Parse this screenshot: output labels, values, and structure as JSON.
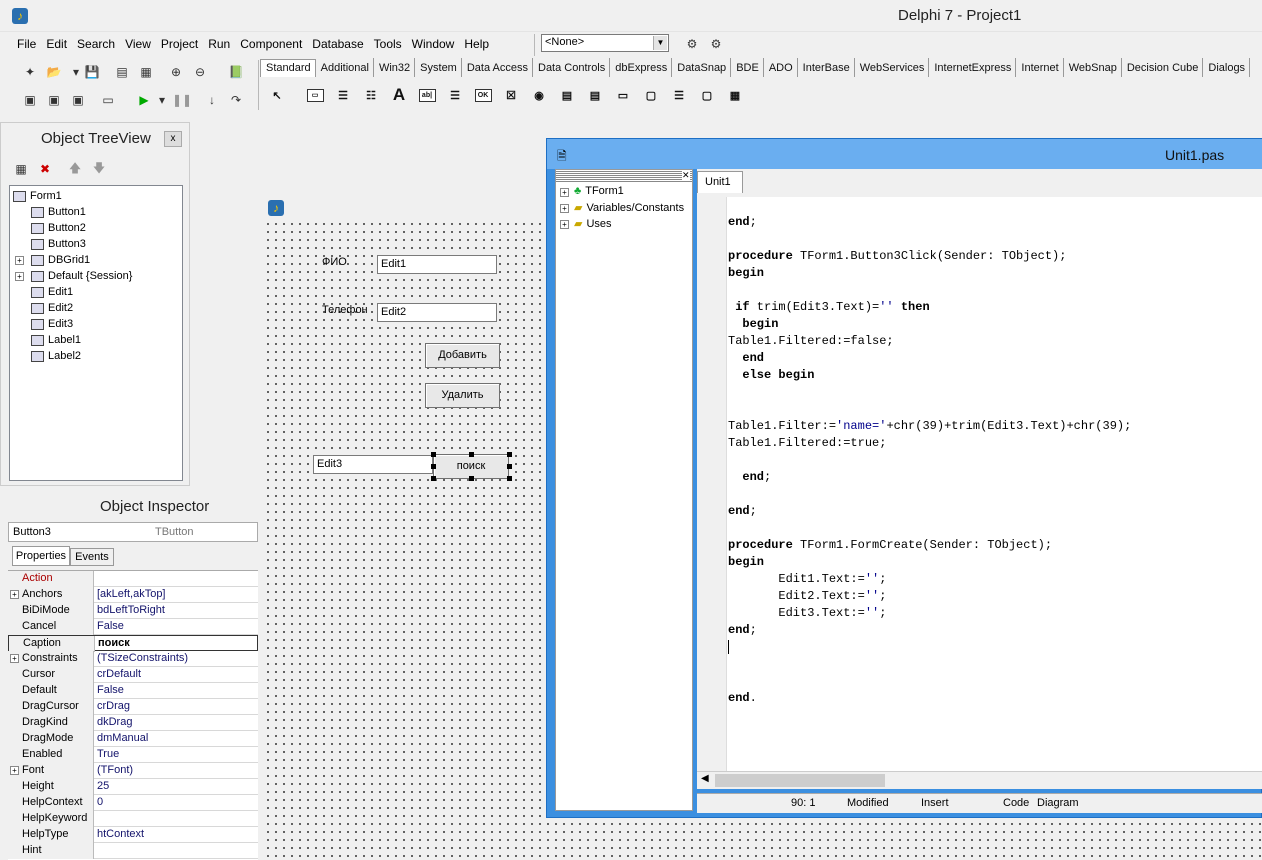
{
  "window": {
    "title": "Delphi 7 - Project1"
  },
  "menu": [
    "File",
    "Edit",
    "Search",
    "View",
    "Project",
    "Run",
    "Component",
    "Database",
    "Tools",
    "Window",
    "Help"
  ],
  "desktop_combo": {
    "value": "<None>"
  },
  "palette_tabs": [
    "Standard",
    "Additional",
    "Win32",
    "System",
    "Data Access",
    "Data Controls",
    "dbExpress",
    "DataSnap",
    "BDE",
    "ADO",
    "InterBase",
    "WebServices",
    "InternetExpress",
    "Internet",
    "WebSnap",
    "Decision Cube",
    "Dialogs"
  ],
  "palette_label_glyph": "A",
  "tree_view": {
    "title": "Object TreeView",
    "close": "x",
    "items": [
      "Form1",
      "Button1",
      "Button2",
      "Button3",
      "DBGrid1",
      "Default {Session}",
      "Edit1",
      "Edit2",
      "Edit3",
      "Label1",
      "Label2"
    ]
  },
  "inspector": {
    "title": "Object Inspector",
    "object_name": "Button3",
    "object_type": "TButton",
    "tabs": [
      "Properties",
      "Events"
    ],
    "rows": [
      {
        "key": "Action",
        "value": ""
      },
      {
        "key": "Anchors",
        "value": "[akLeft,akTop]"
      },
      {
        "key": "BiDiMode",
        "value": "bdLeftToRight"
      },
      {
        "key": "Cancel",
        "value": "False"
      },
      {
        "key": "Caption",
        "value": "поиск"
      },
      {
        "key": "Constraints",
        "value": "(TSizeConstraints)"
      },
      {
        "key": "Cursor",
        "value": "crDefault"
      },
      {
        "key": "Default",
        "value": "False"
      },
      {
        "key": "DragCursor",
        "value": "crDrag"
      },
      {
        "key": "DragKind",
        "value": "dkDrag"
      },
      {
        "key": "DragMode",
        "value": "dmManual"
      },
      {
        "key": "Enabled",
        "value": "True"
      },
      {
        "key": "Font",
        "value": "(TFont)"
      },
      {
        "key": "Height",
        "value": "25"
      },
      {
        "key": "HelpContext",
        "value": "0"
      },
      {
        "key": "HelpKeyword",
        "value": ""
      },
      {
        "key": "HelpType",
        "value": "htContext"
      },
      {
        "key": "Hint",
        "value": ""
      }
    ]
  },
  "form": {
    "label_fio": "ФИО",
    "edit1": "Edit1",
    "label_phone": "Телефон",
    "edit2": "Edit2",
    "btn_add": "Добавить",
    "btn_delete": "Удалить",
    "edit3": "Edit3",
    "btn_search": "поиск"
  },
  "editor": {
    "title": "Unit1.pas",
    "tab": "Unit1",
    "explorer": [
      "TForm1",
      "Variables/Constants",
      "Uses"
    ],
    "code_lines": [
      "",
      "end;",
      "",
      "procedure TForm1.Button3Click(Sender: TObject);",
      "begin",
      "",
      " if trim(Edit3.Text)='' then",
      "  begin",
      "Table1.Filtered:=false;",
      "  end",
      "  else begin",
      "",
      "",
      "Table1.Filter:='name='+chr(39)+trim(Edit3.Text)+chr(39);",
      "Table1.Filtered:=true;",
      "",
      "  end;",
      "",
      "end;",
      "",
      "procedure TForm1.FormCreate(Sender: TObject);",
      "begin",
      "       Edit1.Text:='';",
      "       Edit2.Text:='';",
      "       Edit3.Text:='';",
      "end;",
      "",
      "",
      "",
      "end."
    ],
    "status": {
      "position": "90:  1",
      "modified": "Modified",
      "mode": "Insert",
      "tab_code": "Code",
      "tab_diagram": "Diagram"
    }
  }
}
